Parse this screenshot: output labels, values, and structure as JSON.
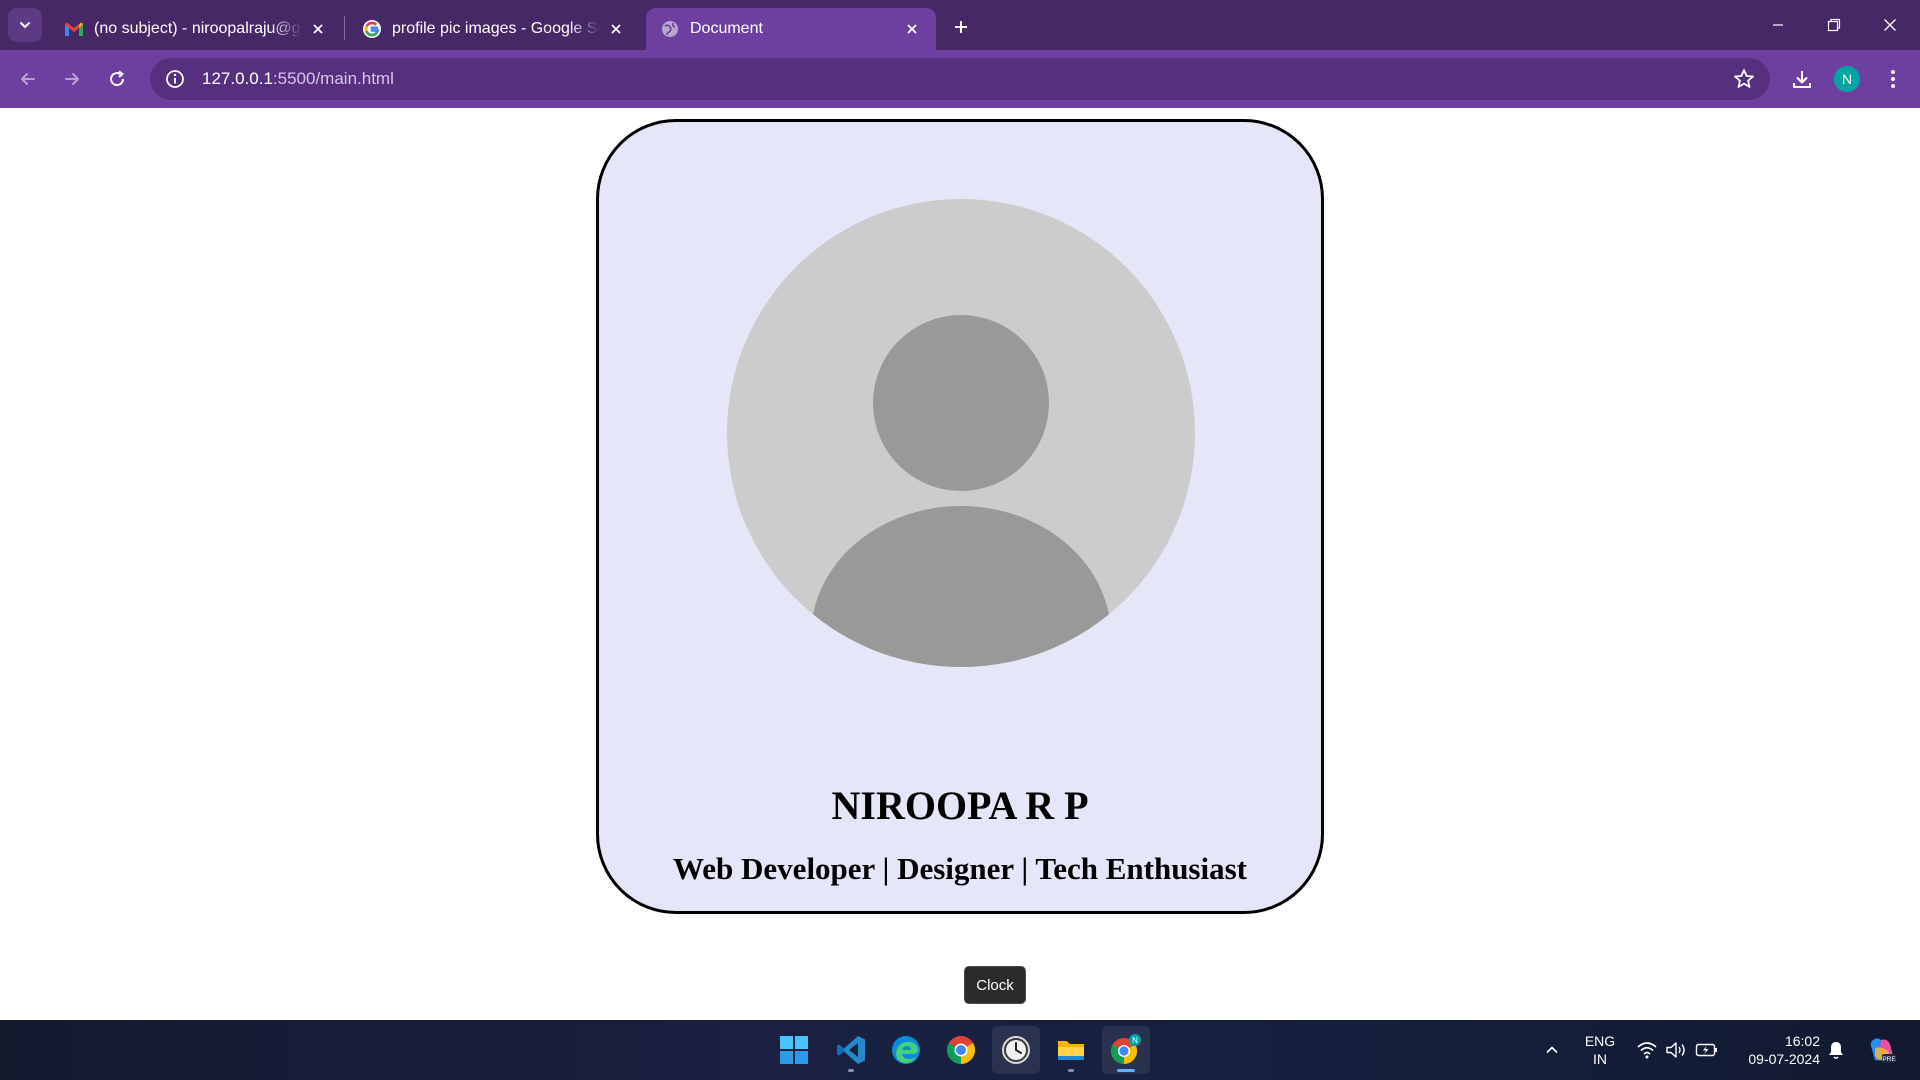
{
  "browser": {
    "tabs": [
      {
        "title": "(no subject) - niroopalraju@gm",
        "icon": "gmail-icon",
        "active": false
      },
      {
        "title": "profile pic images - Google Sea",
        "icon": "google-icon",
        "active": false
      },
      {
        "title": "Document",
        "icon": "globe-icon",
        "active": true
      }
    ],
    "url_host": "127.0.0.1",
    "url_rest": ":5500/main.html",
    "profile_initial": "N"
  },
  "page": {
    "name": "NIROOPA R P",
    "tagline": "Web Developer | Designer | Tech Enthusiast",
    "tooltip": "Clock"
  },
  "taskbar": {
    "apps": [
      "windows-start",
      "vscode",
      "edge",
      "chrome",
      "clock",
      "file-explorer",
      "chrome-profile"
    ],
    "lang_line1": "ENG",
    "lang_line2": "IN",
    "time": "16:02",
    "date": "09-07-2024"
  },
  "colors": {
    "tabstrip": "#472866",
    "toolbar": "#6d3fa0",
    "card_bg": "#e5e6f8",
    "avatar_bg": "#cccccc",
    "avatar_fg": "#999999"
  }
}
